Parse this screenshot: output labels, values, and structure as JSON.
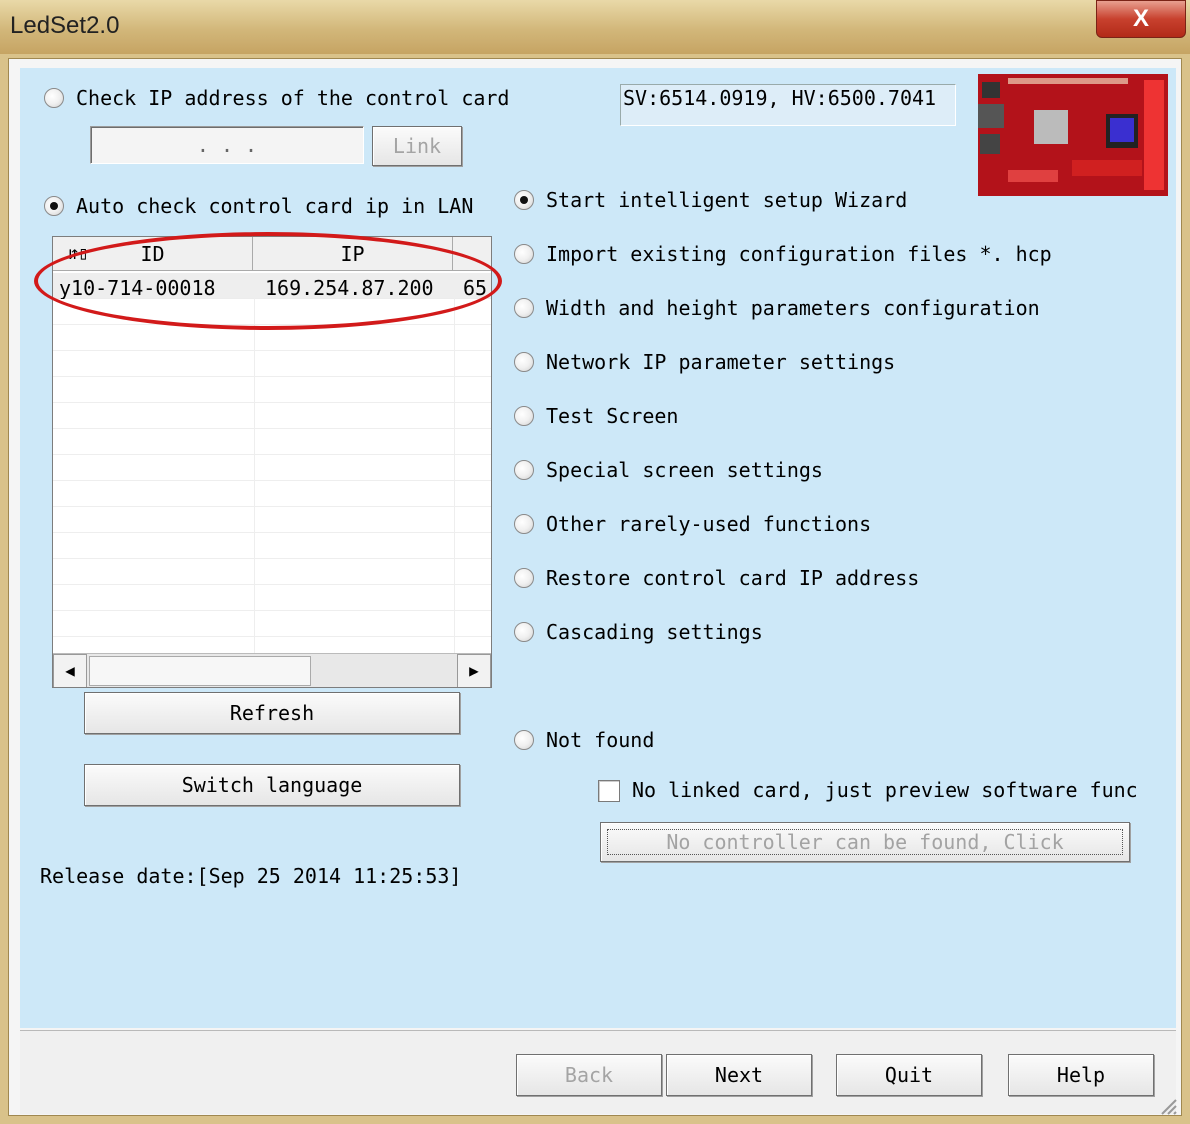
{
  "window": {
    "title": "LedSet2.0",
    "close_glyph": "X",
    "accent_color": "#cde8f8",
    "title_gradient": "#d2b77a"
  },
  "left": {
    "check_ip_label": "Check IP address of the control card",
    "ip_input_value": ".   .   .",
    "link_label": "Link",
    "auto_check_label": "Auto check control card ip in LAN",
    "grid": {
      "headers": [
        "ID",
        "IP"
      ],
      "sort_icon": "sort-icon",
      "rows": [
        {
          "id": "y10-714-00018",
          "ip": "169.254.87.200",
          "extra": "65"
        }
      ]
    },
    "refresh_label": "Refresh",
    "switch_language_label": "Switch language",
    "release_date": "Release date:[Sep 25 2014 11:25:53]"
  },
  "right": {
    "version": "SV:6514.0919, HV:6500.7041",
    "options": [
      "Start intelligent setup Wizard",
      "Import existing configuration files *. hcp",
      "Width and height parameters configuration",
      "Network IP parameter settings",
      "Test Screen",
      "Special screen settings",
      "Other rarely-used functions",
      "Restore control card IP address",
      "Cascading settings"
    ],
    "selected_index": 0,
    "not_found_label": "Not found",
    "preview_checkbox_label": "No linked card, just preview software func",
    "no_controller_label": "No controller can be found, Click"
  },
  "footer": {
    "back_label": "Back",
    "next_label": "Next",
    "quit_label": "Quit",
    "help_label": "Help"
  }
}
